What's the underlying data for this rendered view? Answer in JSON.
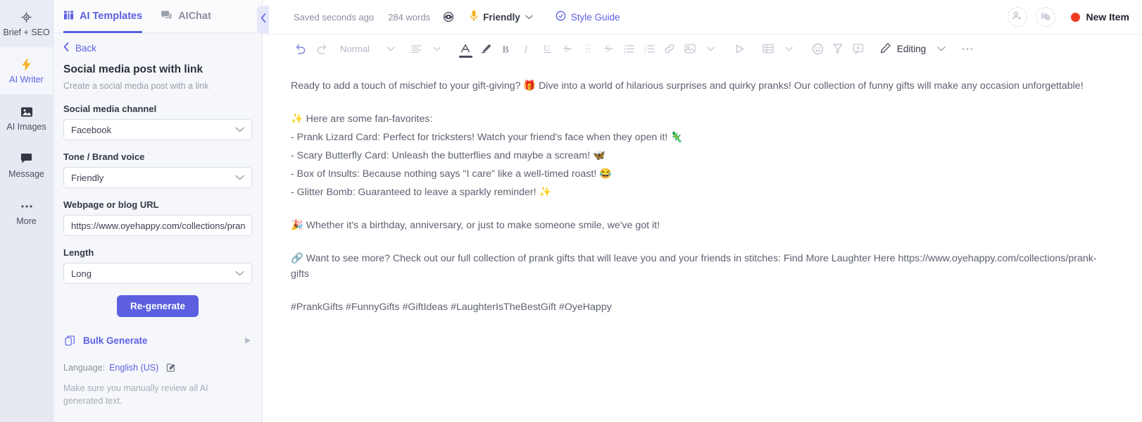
{
  "rail": {
    "items": [
      {
        "label": "Brief + SEO",
        "icon": "target-icon",
        "active": false
      },
      {
        "label": "AI Writer",
        "icon": "bolt-icon",
        "active": true
      },
      {
        "label": "AI Images",
        "icon": "image-icon",
        "active": false
      },
      {
        "label": "Message",
        "icon": "chat-icon",
        "active": false
      },
      {
        "label": "More",
        "icon": "ellipsis-icon",
        "active": false
      }
    ]
  },
  "panel": {
    "tabs": [
      {
        "label": "AI Templates",
        "icon": "grid-icon",
        "active": true
      },
      {
        "label": "AIChat",
        "icon": "chat-bubbles-icon",
        "active": false
      }
    ],
    "back_label": "Back",
    "template_title": "Social media post with link",
    "template_subtitle": "Create a social media post with a link",
    "fields": [
      {
        "label": "Social media channel",
        "value": "Facebook",
        "type": "select"
      },
      {
        "label": "Tone / Brand voice",
        "value": "Friendly",
        "type": "select"
      },
      {
        "label": "Webpage or blog URL",
        "value": "https://www.oyehappy.com/collections/pran",
        "type": "text"
      },
      {
        "label": "Length",
        "value": "Long",
        "type": "select"
      }
    ],
    "regenerate_label": "Re-generate",
    "bulk_generate_label": "Bulk Generate",
    "language_prefix": "Language:",
    "language_value": "English (US)",
    "disclaimer": "Make sure you manually review all AI generated text.",
    "collapse_icon": "chevron-left-icon"
  },
  "topbar": {
    "saved_text": "Saved seconds ago",
    "word_count": "284 words",
    "eye_icon": "eye-icon",
    "tone_label": "Friendly",
    "tone_icon": "microphone-icon",
    "style_guide_label": "Style Guide",
    "style_guide_icon": "check-circle-icon",
    "invite_icon": "add-user-icon",
    "media_icon": "add-media-icon",
    "new_item_label": "New Item",
    "record_dot_color": "#f03b20"
  },
  "toolbar": {
    "undo_icon": "undo-icon",
    "redo_icon": "redo-icon",
    "style_label": "Normal",
    "align_icon": "align-left-icon",
    "font_color_icon": "font-color-icon",
    "highlight_icon": "highlighter-icon",
    "bold_icon": "bold-icon",
    "italic_icon": "italic-icon",
    "underline_icon": "underline-icon",
    "strikethrough_icon": "strikethrough-icon",
    "more_icon": "drag-dots-icon",
    "strike_icon_2": "strikethrough-icon",
    "bullet_list_icon": "bullet-list-icon",
    "numbered_list_icon": "numbered-list-icon",
    "link_icon": "link-icon",
    "image_icon": "image-icon",
    "video_icon": "play-icon",
    "table_icon": "table-icon",
    "emoji_icon": "emoji-icon",
    "clear_format_icon": "clear-format-icon",
    "comment_icon": "comment-icon",
    "editing_label": "Editing",
    "editing_icon": "pencil-icon",
    "chevron_icon": "chevron-down-icon",
    "overflow_icon": "ellipsis-icon"
  },
  "document": {
    "paragraphs": [
      {
        "id": "p1",
        "text": "Ready to add a touch of mischief to your gift-giving? 🎁 Dive into a world of hilarious surprises and quirky pranks! Our collection of funny gifts will make any occasion unforgettable!"
      },
      {
        "id": "p2",
        "text": "✨ Here are some fan-favorites:"
      },
      {
        "id": "p3",
        "text": "- Prank Lizard Card: Perfect for tricksters! Watch your friend's face when they open it! 🦎"
      },
      {
        "id": "p4",
        "text": "- Scary Butterfly Card: Unleash the butterflies and maybe a scream! 🦋"
      },
      {
        "id": "p5",
        "text": "- Box of Insults: Because nothing says \"I care\" like a well-timed roast! 😂"
      },
      {
        "id": "p6",
        "text": "- Glitter Bomb: Guaranteed to leave a sparkly reminder! ✨"
      },
      {
        "id": "p7",
        "text": "🎉 Whether it's a birthday, anniversary, or just to make someone smile, we've got it!"
      },
      {
        "id": "p8",
        "text": "🔗 Want to see more? Check out our full collection of prank gifts that will leave you and your friends in stitches: Find More Laughter Here https://www.oyehappy.com/collections/prank-gifts"
      },
      {
        "id": "p9",
        "text": "#PrankGifts #FunnyGifts #GiftIdeas #LaughterIsTheBestGift #OyeHappy"
      }
    ]
  },
  "colors": {
    "accent": "#5b5fe0",
    "rail_bg": "#e6e9f2",
    "panel_bg": "#f6f7fb",
    "text": "#5d6270",
    "grammar_underline": "#e8b33a"
  }
}
